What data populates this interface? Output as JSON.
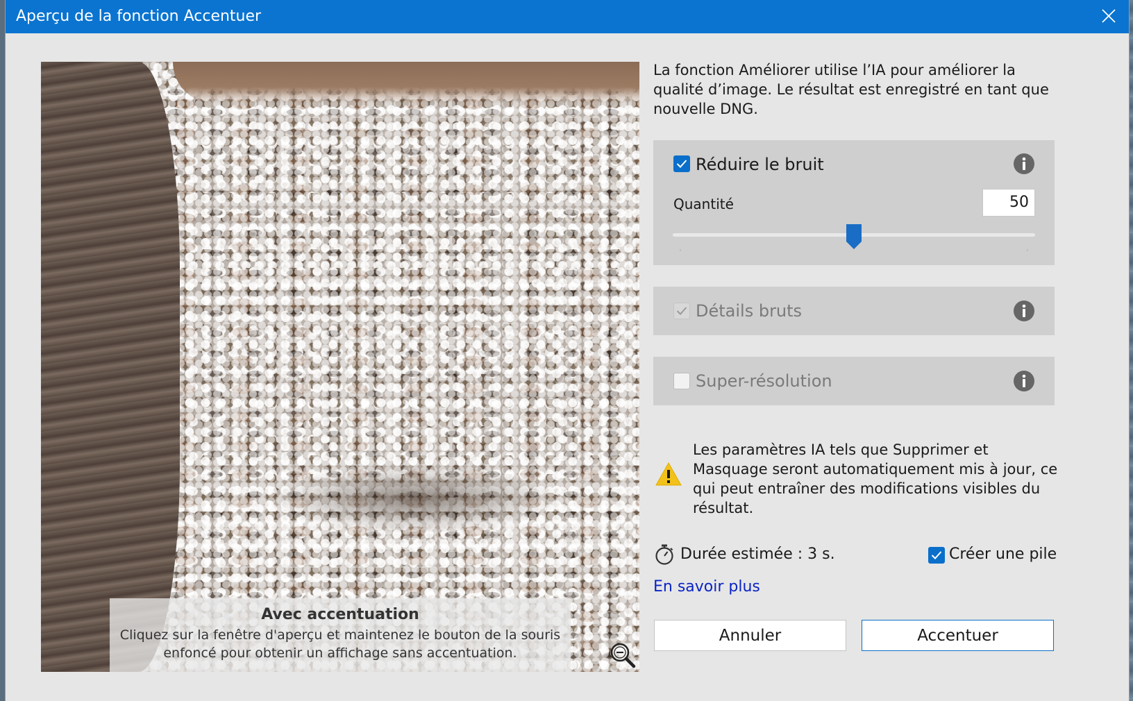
{
  "dialog": {
    "title": "Aperçu de la fonction Accentuer",
    "description": "La fonction Améliorer utilise l’IA pour améliorer la qualité d’image. Le résultat est enregistré en tant que nouvelle DNG."
  },
  "preview": {
    "caption_title": "Avec accentuation",
    "caption_line1": "Cliquez sur la fenêtre d'aperçu et maintenez le bouton de la souris",
    "caption_line2": "enfoncé pour obtenir un affichage sans accentuation."
  },
  "options": {
    "denoise": {
      "label": "Réduire le bruit",
      "checked": true,
      "amount_label": "Quantité",
      "amount_value": "50",
      "amount_fraction": 0.5
    },
    "raw_details": {
      "label": "Détails bruts",
      "checked": true,
      "disabled": true
    },
    "super_resolution": {
      "label": "Super-résolution",
      "checked": false
    }
  },
  "warning": {
    "text": "Les paramètres IA tels que Supprimer et Masquage seront automatiquement mis à jour, ce qui peut entraîner des modifications visibles du résultat."
  },
  "footer": {
    "duration": "Durée estimée : 3 s.",
    "create_stack_label": "Créer une pile",
    "create_stack_checked": true,
    "learn_more": "En savoir plus",
    "cancel_label": "Annuler",
    "enhance_label": "Accentuer"
  },
  "colors": {
    "titlebar": "#0a74d0",
    "accent": "#0a6fca",
    "link": "#0b24c4",
    "warning": "#f2c21a"
  }
}
